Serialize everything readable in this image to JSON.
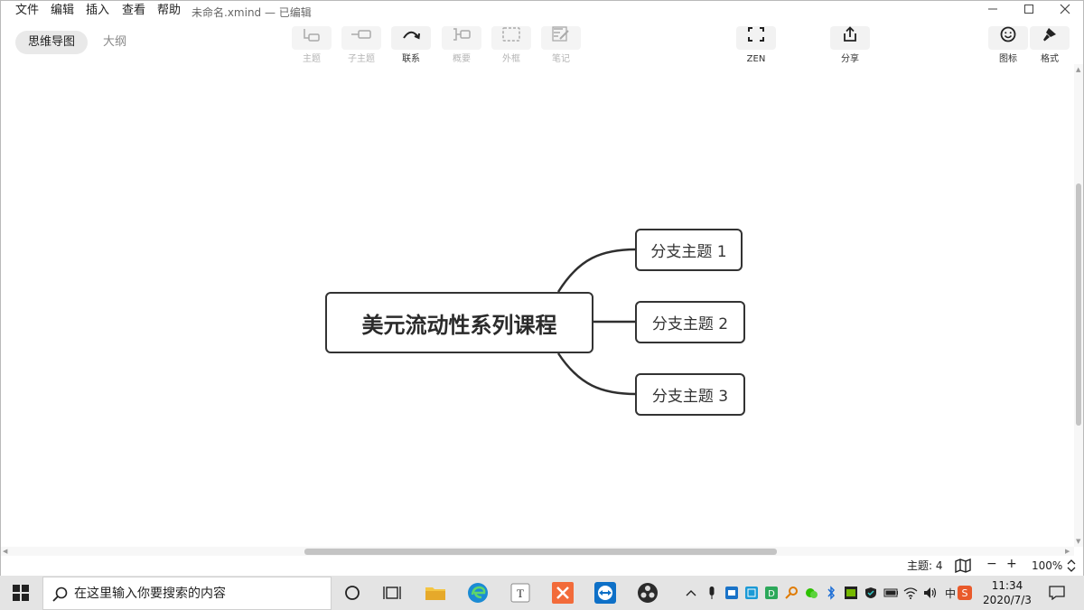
{
  "menu": {
    "file": "文件",
    "edit": "编辑",
    "insert": "插入",
    "view": "查看",
    "help": "帮助",
    "doc_title": "未命名.xmind — 已编辑"
  },
  "toolbar": {
    "mindmap_tab": "思维导图",
    "outline_tab": "大纲",
    "topic": "主题",
    "subtopic": "子主题",
    "relationship": "联系",
    "summary": "概要",
    "boundary": "外框",
    "note": "笔记",
    "zen": "ZEN",
    "share": "分享",
    "icon": "图标",
    "format": "格式"
  },
  "mindmap": {
    "central": "美元流动性系列课程",
    "branches": [
      "分支主题 1",
      "分支主题 2",
      "分支主题 3"
    ]
  },
  "status": {
    "topic_count": "主题: 4",
    "zoom_minus": "−",
    "zoom_plus": "+",
    "zoom": "100%"
  },
  "taskbar": {
    "search_placeholder": "在这里输入你要搜索的内容",
    "ime": "中",
    "time": "11:34",
    "date": "2020/7/3"
  },
  "colors": {
    "node_border": "#333333",
    "accent_orange": "#f26b3a",
    "taskbar_bg": "#e4e4e4"
  }
}
